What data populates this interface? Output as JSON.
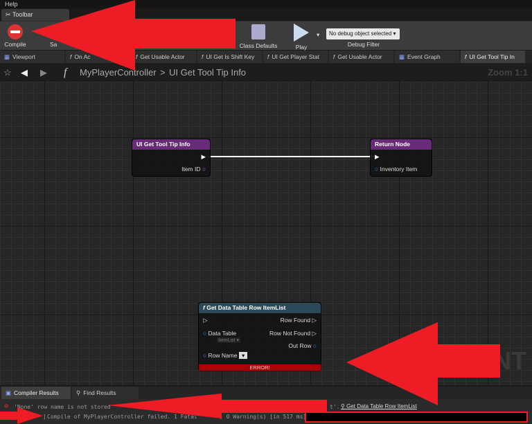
{
  "menu": {
    "help": "Help"
  },
  "toolbar_tab": {
    "label": "Toolbar"
  },
  "toolbar": {
    "compile": "Compile",
    "save_partial": "Sa",
    "class_defaults": "Class Defaults",
    "play": "Play",
    "debug_select": "No debug object selected",
    "debug_filter": "Debug Filter"
  },
  "tabs": [
    {
      "label": "Viewport"
    },
    {
      "label": "On Ac"
    },
    {
      "label": "Get Usable Actor"
    },
    {
      "label": "UI Get Is Shift Key"
    },
    {
      "label": "UI Get Player Stat"
    },
    {
      "label": "Get Usable Actor"
    },
    {
      "label": "Event Graph"
    },
    {
      "label": "UI Get Tool Tip In"
    }
  ],
  "breadcrumb": {
    "parent": "MyPlayerController",
    "sep": ">",
    "current": "UI Get Tool Tip Info",
    "zoom": "Zoom 1:1"
  },
  "nodes": {
    "entry": {
      "title": "UI Get Tool Tip Info",
      "pin": "Item ID",
      "color": "#6a2a7a"
    },
    "return": {
      "title": "Return Node",
      "pin": "Inventory Item",
      "color": "#6a2a7a"
    },
    "get_row": {
      "title": "Get Data Table Row ItemList",
      "data_table": "Data Table",
      "data_table_value": "ItemList",
      "row_name": "Row Name",
      "row_found": "Row Found",
      "row_not_found": "Row Not Found",
      "out_row": "Out Row",
      "error": "ERROR!",
      "color": "#2a4a5a"
    }
  },
  "watermark": "INT",
  "bottom_tabs": [
    {
      "label": "Compiler Results"
    },
    {
      "label": "Find Results"
    }
  ],
  "results": {
    "line1": "'None' row name is not stored",
    "line1_end": "t'.",
    "link": "Get Data Table Row ItemList",
    "line2_start": "]",
    "line2": "Compile of MyPlayerController failed. 1 Fatal",
    "line2_end": ") 0 Warning(s) [in 517 ms]"
  },
  "annotation_color": "#ee1c24"
}
